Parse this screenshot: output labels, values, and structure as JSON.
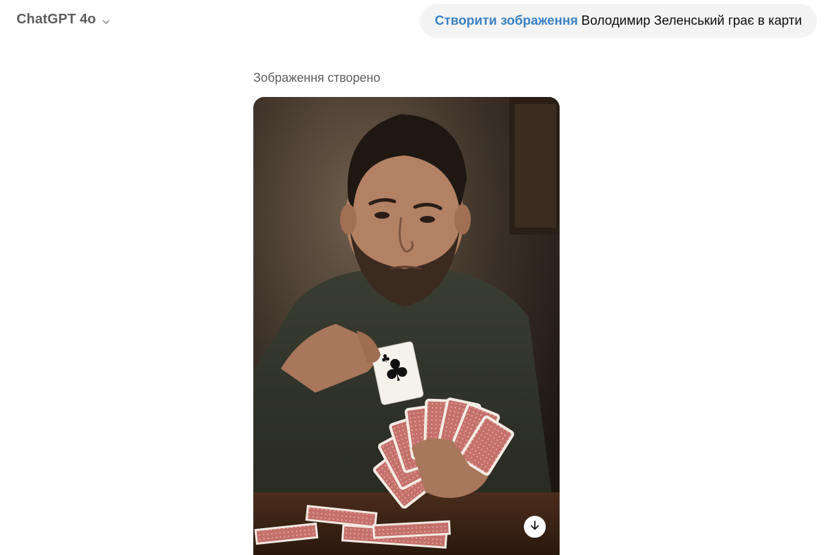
{
  "header": {
    "model_name": "ChatGPT 4o",
    "model_menu_icon": "chevron-down-icon"
  },
  "user_message": {
    "tool_label": "Створити зображення",
    "prompt": "Володимир Зеленський грає в карти"
  },
  "assistant": {
    "status_text": "Зображення створено",
    "image": {
      "subject": "man-playing-cards",
      "download_icon": "arrow-down-icon"
    }
  },
  "colors": {
    "tool_accent": "#3b82c4",
    "bubble_bg": "#f4f4f4",
    "muted_text": "#5d5d5d"
  }
}
